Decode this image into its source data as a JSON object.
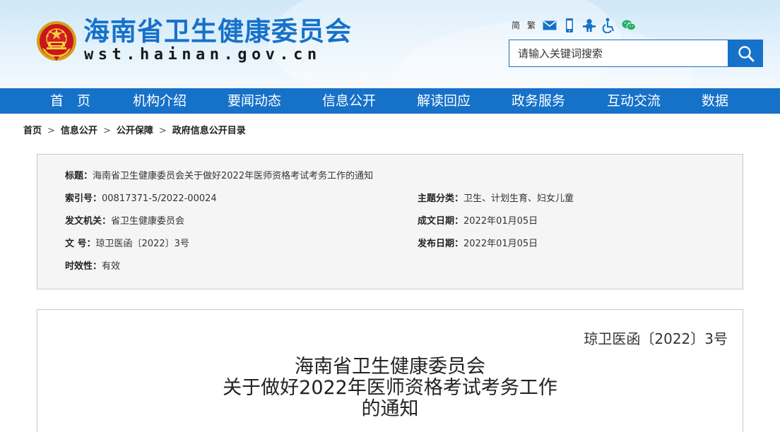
{
  "header": {
    "site_title": "海南省卫生健康委员会",
    "site_domain": "wst.hainan.gov.cn",
    "tools": {
      "simplified": "简",
      "traditional": "繁",
      "icons": [
        "mail-icon",
        "mobile-icon",
        "elder-mode-icon",
        "accessibility-icon",
        "wechat-icon"
      ]
    },
    "search": {
      "placeholder": "请输入关键词搜索"
    },
    "accent_color": "#1671c9"
  },
  "nav": {
    "items": [
      "首　页",
      "机构介绍",
      "要闻动态",
      "信息公开",
      "解读回应",
      "政务服务",
      "互动交流",
      "数据"
    ]
  },
  "breadcrumb": {
    "items": [
      "首页",
      "信息公开",
      "公开保障",
      "政府信息公开目录"
    ],
    "separator": ">"
  },
  "info": {
    "title": {
      "label": "标题：",
      "value": "海南省卫生健康委员会关于做好2022年医师资格考试考务工作的通知"
    },
    "index_no": {
      "label": "索引号：",
      "value": "00817371-5/2022-00024"
    },
    "category": {
      "label": "主题分类：",
      "value": "卫生、计划生育、妇女儿童"
    },
    "issuer": {
      "label": "发文机关：",
      "value": "省卫生健康委员会"
    },
    "created": {
      "label": "成文日期：",
      "value": "2022年01月05日"
    },
    "doc_no": {
      "label": "文 号：",
      "value": "琼卫医函〔2022〕3号"
    },
    "published": {
      "label": "发布日期：",
      "value": "2022年01月05日"
    },
    "validity": {
      "label": "时效性：",
      "value": "有效"
    }
  },
  "document": {
    "number": "琼卫医函〔2022〕3号",
    "title_lines": [
      "海南省卫生健康委员会",
      "关于做好2022年医师资格考试考务工作",
      "的通知"
    ]
  }
}
